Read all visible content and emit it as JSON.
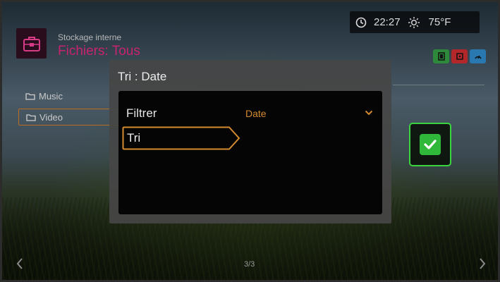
{
  "header": {
    "app_icon": "storage-briefcase-icon",
    "storage_label": "Stockage interne",
    "title": "Fichiers: Tous"
  },
  "status": {
    "clock_icon": "clock-icon",
    "time": "22:27",
    "weather_icon": "sun-icon",
    "temperature": "75°F"
  },
  "mini_buttons": [
    {
      "name": "green-action-button",
      "color": "#2d8a3a"
    },
    {
      "name": "red-action-button",
      "color": "#b3262a"
    },
    {
      "name": "blue-action-button",
      "color": "#2a78b0"
    }
  ],
  "folders": [
    {
      "label": "Music",
      "icon": "folder-icon"
    },
    {
      "label": "Video",
      "icon": "folder-icon",
      "selected": true
    }
  ],
  "modal": {
    "title": "Tri : Date",
    "filter_label": "Filtrer",
    "filter_value": "Date",
    "sort_label": "Tri"
  },
  "footer": {
    "page_indicator": "3/3"
  },
  "colors": {
    "accent_pink": "#c8236f",
    "accent_orange": "#d48a2e",
    "confirm_green": "#39d43f"
  }
}
